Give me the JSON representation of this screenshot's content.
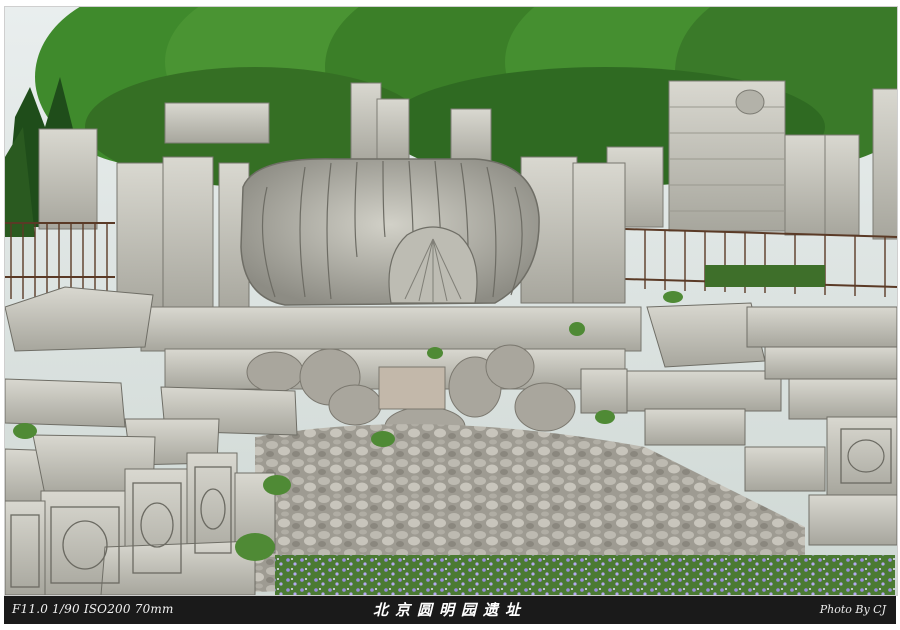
{
  "photo": {
    "scene": "Old Summer Palace ruins with carved stone shell fountain",
    "palette": {
      "foliage": "#3f7d2c",
      "foliage_dark": "#24521b",
      "sky": "#dfe6e6",
      "stone": "#c9c8bf",
      "stone_dark": "#8f8e86",
      "rubble": "#a8a59c",
      "flowers": "#8a7fd6",
      "fence": "#5a3a26"
    }
  },
  "caption": {
    "exif": "F11.0 1/90 ISO200  70mm",
    "title": "北京圆明园遗址",
    "credit": "Photo By CJ"
  }
}
